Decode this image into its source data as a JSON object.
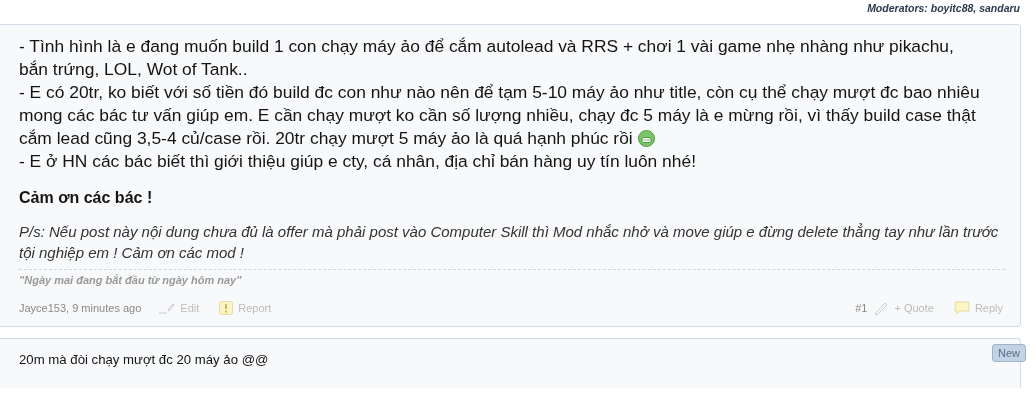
{
  "moderators": "Moderators: boyitc88, sandaru",
  "post": {
    "paragraphs": [
      {
        "text": "- Tình hình là e đang muốn build 1 con chạy máy ảo để cắm autolead và RRS + chơi 1 vài game nhẹ nhàng như pikachu, bắn trứng, LOL, Wot of Tank..",
        "smiley": false
      },
      {
        "text": "- E có 20tr, ko biết với số tiền đó build đc con như nào nên để tạm 5-10 máy ảo như title, còn cụ thể chạy mượt đc bao nhiêu mong các bác tư vấn giúp em. E cần chạy mượt ko cần số lượng nhiều, chạy đc 5 máy là e mừng rồi, vì thấy build case thật cắm lead cũng 3,5-4 củ/case rồi. 20tr chạy mượt 5 máy ảo là quá hạnh phúc rồi",
        "smiley": true
      },
      {
        "text": "- E ở HN các bác biết thì giới thiệu giúp e cty, cá nhân, địa chỉ bán hàng uy tín luôn nhé!",
        "smiley": false
      }
    ],
    "thanks": "Cảm ơn các bác !",
    "ps": "P/s: Nếu post này nội dung chưa đủ là offer mà phải post vào Computer Skill thì Mod nhắc nhở và move giúp e đừng delete thẳng tay như lần trước tội nghiệp em ! Cảm ơn các mod !",
    "signature": "\"Ngày mai đang bắt đầu từ ngày hôm nay\"",
    "author_time": "Jayce153, 9 minutes ago",
    "edit": "Edit",
    "report": "Report",
    "number": "#1",
    "quote": "+ Quote",
    "reply": "Reply"
  },
  "reply_post": {
    "text": "20m mà đòi chạy mượt đc 20 máy ảo @@",
    "badge": "New"
  }
}
